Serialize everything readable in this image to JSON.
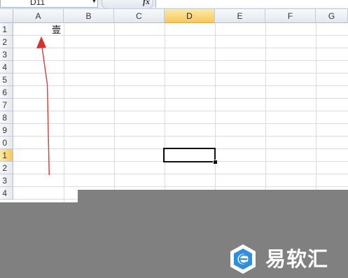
{
  "formula_bar": {
    "name_box_value": "D11",
    "fx_label": "fx"
  },
  "columns": [
    "A",
    "B",
    "C",
    "D",
    "E",
    "F",
    "G"
  ],
  "active_column": "D",
  "rows": [
    "1",
    "2",
    "3",
    "4",
    "5",
    "6",
    "7",
    "8",
    "9",
    "0",
    "1",
    "2",
    "3",
    "4"
  ],
  "active_row_index": 10,
  "cells": {
    "A1": "壹"
  },
  "annotation": {
    "arrow_color": "#d9302b",
    "pointing_to": "A1"
  },
  "overlay_color": "#808080",
  "watermark": {
    "text": "易软汇",
    "logo_icon": "brand-logo-icon"
  }
}
